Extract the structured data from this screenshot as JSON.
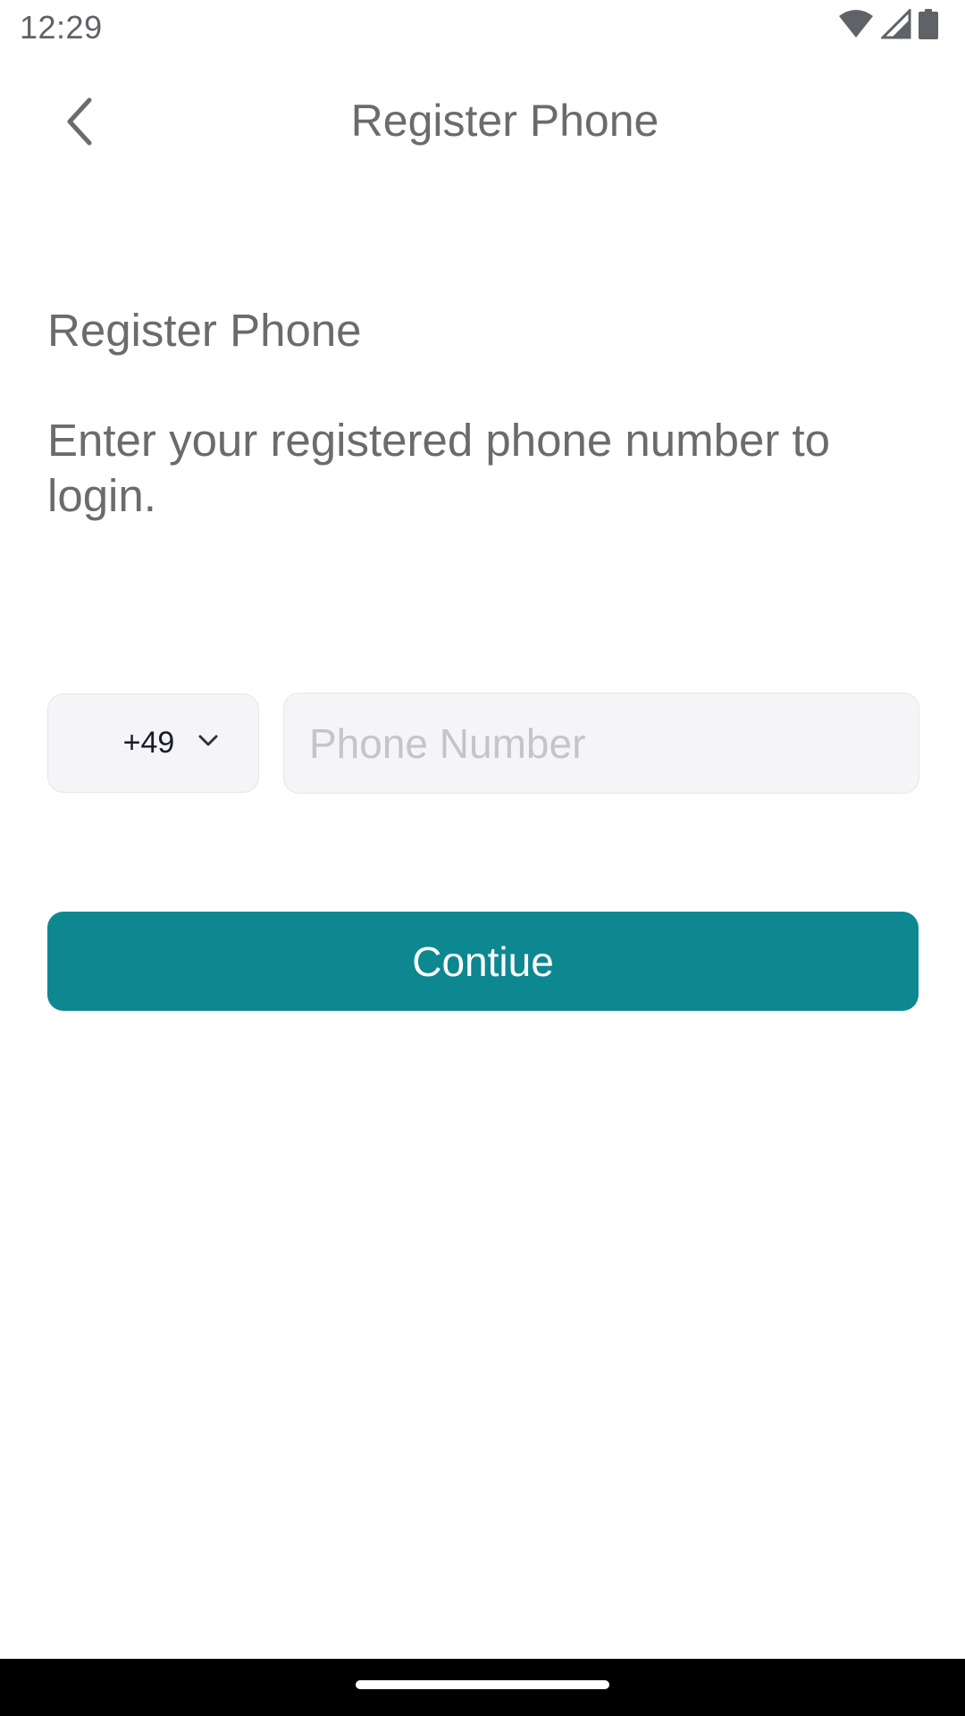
{
  "status_bar": {
    "time": "12:29",
    "icons": [
      "wifi-icon",
      "signal-icon",
      "battery-icon"
    ]
  },
  "app_bar": {
    "title": "Register Phone",
    "back_icon": "chevron-left-icon"
  },
  "content": {
    "heading": "Register Phone",
    "description": "Enter your registered phone number to login."
  },
  "form": {
    "country_code": "+49",
    "country_chevron_icon": "chevron-down-icon",
    "phone_placeholder": "Phone Number",
    "phone_value": ""
  },
  "actions": {
    "continue_label": "Contiue"
  },
  "colors": {
    "primary": "#0e8890",
    "text_muted": "#6b6b6b",
    "input_bg": "#f5f5f7",
    "placeholder": "#c4c4cc"
  }
}
